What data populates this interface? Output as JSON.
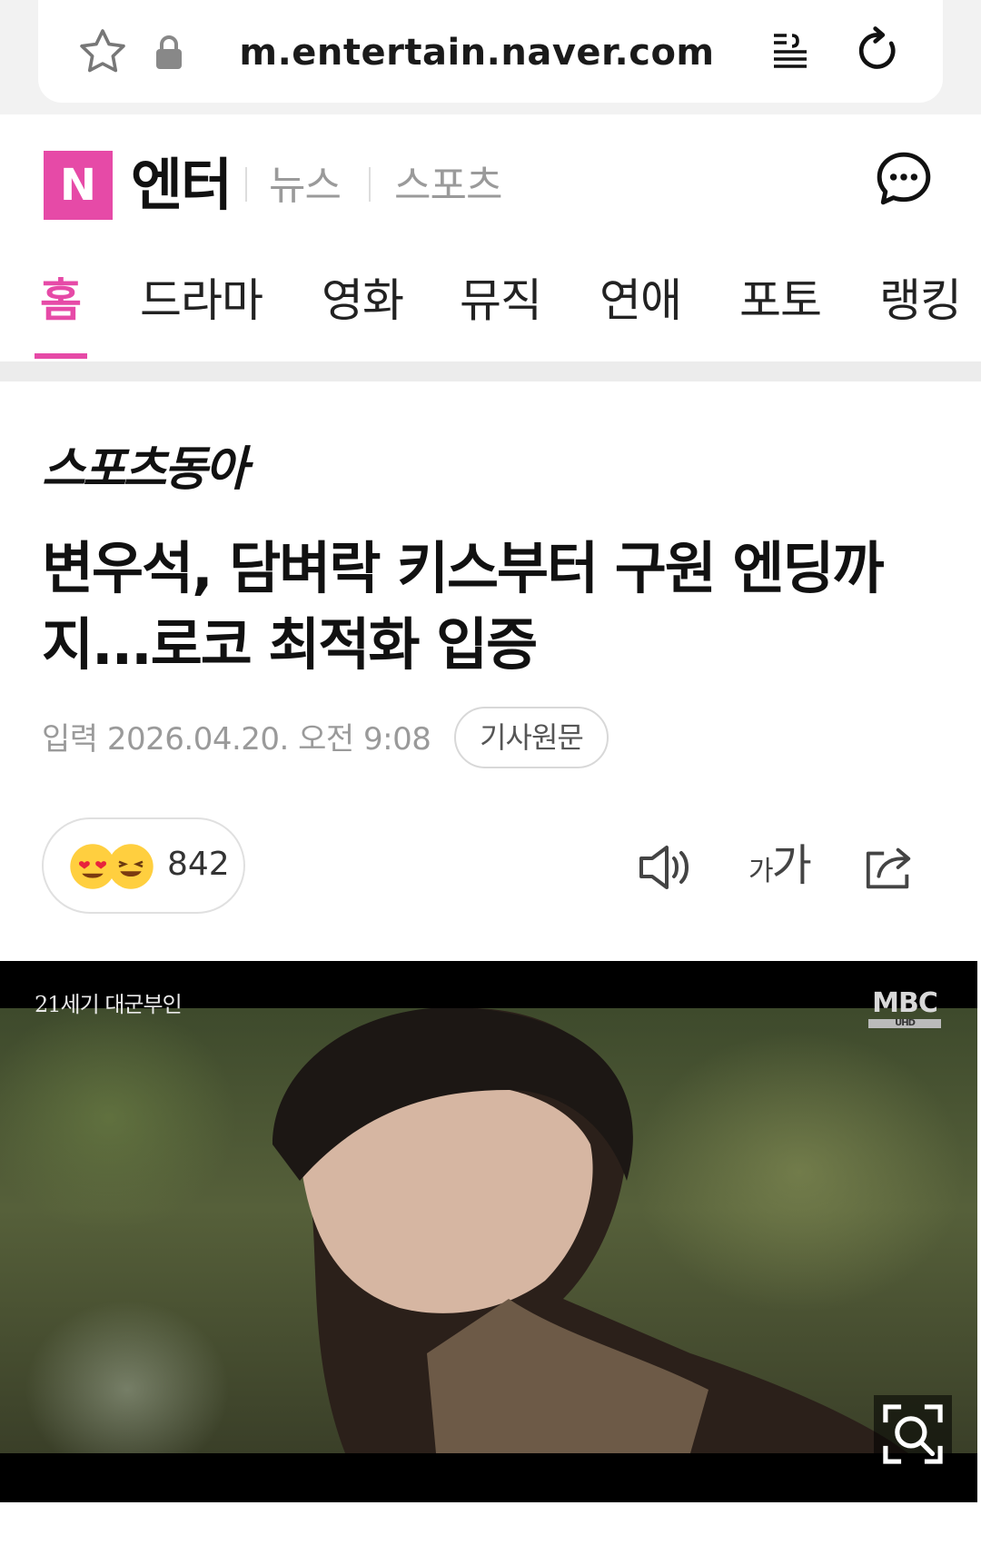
{
  "browser": {
    "url": "m.entertain.naver.com",
    "icons": [
      "star-icon",
      "lock-icon",
      "reader-mode-icon",
      "reload-icon"
    ]
  },
  "header": {
    "logo_letter": "N",
    "title": "엔터",
    "links": [
      "뉴스",
      "스포츠"
    ],
    "accent_color": "#e64aa7"
  },
  "tabs": [
    {
      "label": "홈",
      "active": true
    },
    {
      "label": "드라마",
      "active": false
    },
    {
      "label": "영화",
      "active": false
    },
    {
      "label": "뮤직",
      "active": false
    },
    {
      "label": "연애",
      "active": false
    },
    {
      "label": "포토",
      "active": false
    },
    {
      "label": "랭킹",
      "active": false
    }
  ],
  "article": {
    "press": "스포츠동아",
    "headline": "변우석, 담벼락 키스부터 구원 엔딩까지...로코 최적화 입증",
    "date": "입력 2026.04.20. 오전 9:08",
    "original_label": "기사원문",
    "reaction_count": "842",
    "font_size_small": "가",
    "font_size_big": "가"
  },
  "photo": {
    "caption": "21세기 대군부인",
    "broadcaster": "MBC",
    "broadcaster_sub": "UHD"
  }
}
